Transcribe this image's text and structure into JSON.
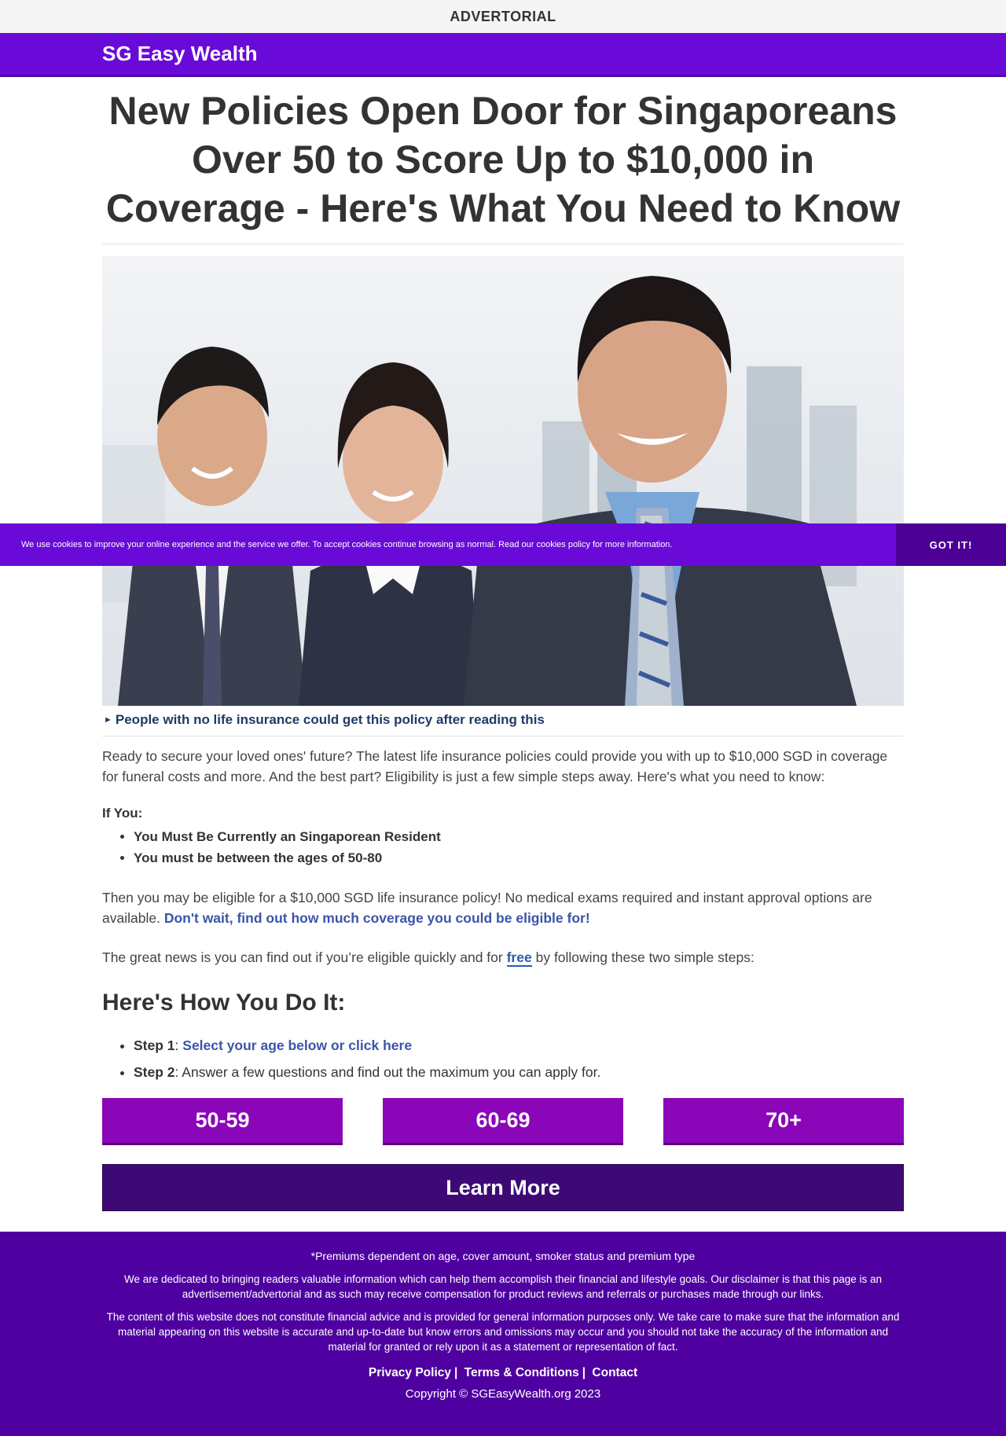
{
  "colors": {
    "brand": "#6a0ad8",
    "accent": "#8a06b8",
    "footer": "#4f00a0"
  },
  "top_label": "ADVERTORIAL",
  "brand": {
    "name": "SG Easy Wealth"
  },
  "article": {
    "headline": "New Policies Open Door for Singaporeans Over 50 to Score Up to $10,000 in Coverage - Here's What You Need to Know",
    "caption": "People with no life insurance could get this policy after reading this",
    "intro": "Ready to secure your loved ones' future? The latest life insurance policies could provide you with up to $10,000 SGD in coverage for funeral costs and more. And the best part? Eligibility is just a few simple steps away. Here's what you need to know:",
    "if_you": "If You:",
    "requirements": [
      "You Must Be Currently an Singaporean Resident",
      "You must be between the ages of 50-80"
    ],
    "eligible_text": "Then you may be eligible for a $10,000 SGD life insurance policy! No medical exams required and instant approval options are available.",
    "eligible_link": "Don't wait, find out how much coverage you could be eligible for!",
    "great_news_before": "The great news is you can find out if you’re eligible quickly and for",
    "free_link": "free",
    "great_news_after": "by following these two simple steps:",
    "howto_title": "Here's How You Do It:",
    "steps": [
      {
        "label": "Step 1",
        "link": "Select your age below or click here",
        "text": ""
      },
      {
        "label": "Step 2",
        "link": "",
        "text": "Answer a few questions and find out the maximum you can apply for."
      }
    ],
    "age_buttons": [
      "50-59",
      "60-69",
      "70+"
    ],
    "learn_more": "Learn More"
  },
  "cookie": {
    "text": "We use cookies to improve your online experience and the service we offer. To accept cookies continue browsing as normal. Read our cookies policy for more information.",
    "button": "GOT IT!"
  },
  "footer": {
    "premiums": "*Premiums dependent on age, cover amount, smoker status and premium type",
    "disclaimer1": "We are dedicated to bringing readers valuable information which can help them accomplish their financial and lifestyle goals. Our disclaimer is that this page is an advertisement/advertorial and as such may receive compensation for product reviews and referrals or purchases made through our links.",
    "disclaimer2": "The content of this website does not constitute financial advice and is provided for general information purposes only. We take care to make sure that the information and material appearing on this website is accurate and up-to-date but know errors and omissions may occur and you should not take the accuracy of the information and material for granted or rely upon it as a statement or representation of fact.",
    "links": [
      "Privacy Policy",
      "Terms & Conditions",
      "Contact"
    ],
    "copyright": "Copyright © SGEasyWealth.org 2023"
  },
  "hero_image": {
    "subject": "three smiling business people in suits"
  }
}
